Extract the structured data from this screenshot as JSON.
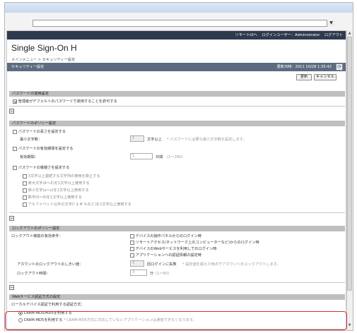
{
  "browser": {
    "dropdown_glyph": "▼"
  },
  "app": {
    "header": {
      "home_link": "リモートUIへ",
      "user_label": "ログインユーザー：Administrator",
      "logout_link": "ログアウト"
    },
    "logo": "Single Sign-On H",
    "breadcrumb": "メインメニュー > セキュリティー設定",
    "title": "セキュリティー設定",
    "datetime": "更新日時：2011 10/28 1:35:42",
    "buttons": {
      "update": "更新",
      "cancel": "キャンセル"
    },
    "password_use": {
      "heading": "パスワードの運用設定",
      "checkbox_label": "管理者がデフォルトのパスワードで運用することを許可する"
    },
    "password_policy": {
      "heading": "パスワードのポリシー設定",
      "length": {
        "label": "パスワードの長さを設定する",
        "min_label": "最小文字数：",
        "value": "1",
        "unit": "文字以上",
        "note": "* パスワードに必要な最小文字数を設定します。"
      },
      "expiry": {
        "label": "パスワードの有効期間を設定する",
        "period_label": "有効期間：",
        "value": "1",
        "unit": "日間",
        "range": "(1〜180)"
      },
      "complexity": {
        "label": "パスワードの複雑さを設定する",
        "rules": [
          "3文字以上連続する文字列の使用を禁止する",
          "英大文字(A〜Z)を1文字以上使用する",
          "英小文字(a〜z)を1文字以上使用する",
          "数字(0〜9)を1文字以上使用する",
          "アルファベット以外の文字(! $ # %など)を1文字以上使用する"
        ]
      }
    },
    "lockout": {
      "heading": "ロックアウトのポリシー設定",
      "condition_label": "ロックアウト機能の有効条件：",
      "conditions": [
        "デバイスの操作パネルからのログイン時",
        "リモートアクセス(ネットワーク上のコンピューターなど)からのログイン時",
        "デバイスのWebサービスを利用してのログイン時",
        "アプリケーションへの認証情報の設定時"
      ],
      "threshold_label": "アカウントのロックアウトのしきい値：",
      "threshold_value": "3",
      "threshold_unit": "回ログインに失敗",
      "threshold_note": "* 設定値を超えた時点でアカウントをロックアウトします。",
      "duration_label": "ロックアウト時間：",
      "duration_value": "3",
      "duration_unit": "分",
      "duration_range": "(1〜60)"
    },
    "web_auth": {
      "heading": "Webサービス認証方式の設定",
      "method_label": "ローカルデバイス認証で利用する認証方式：",
      "options": [
        "CRAM-MD5/MD5を利用する",
        "CRAM-MD5を利用する"
      ],
      "option_note": "* CRAM-MD5方式に対応していないアプリケーションは通信できなくなります。"
    }
  }
}
